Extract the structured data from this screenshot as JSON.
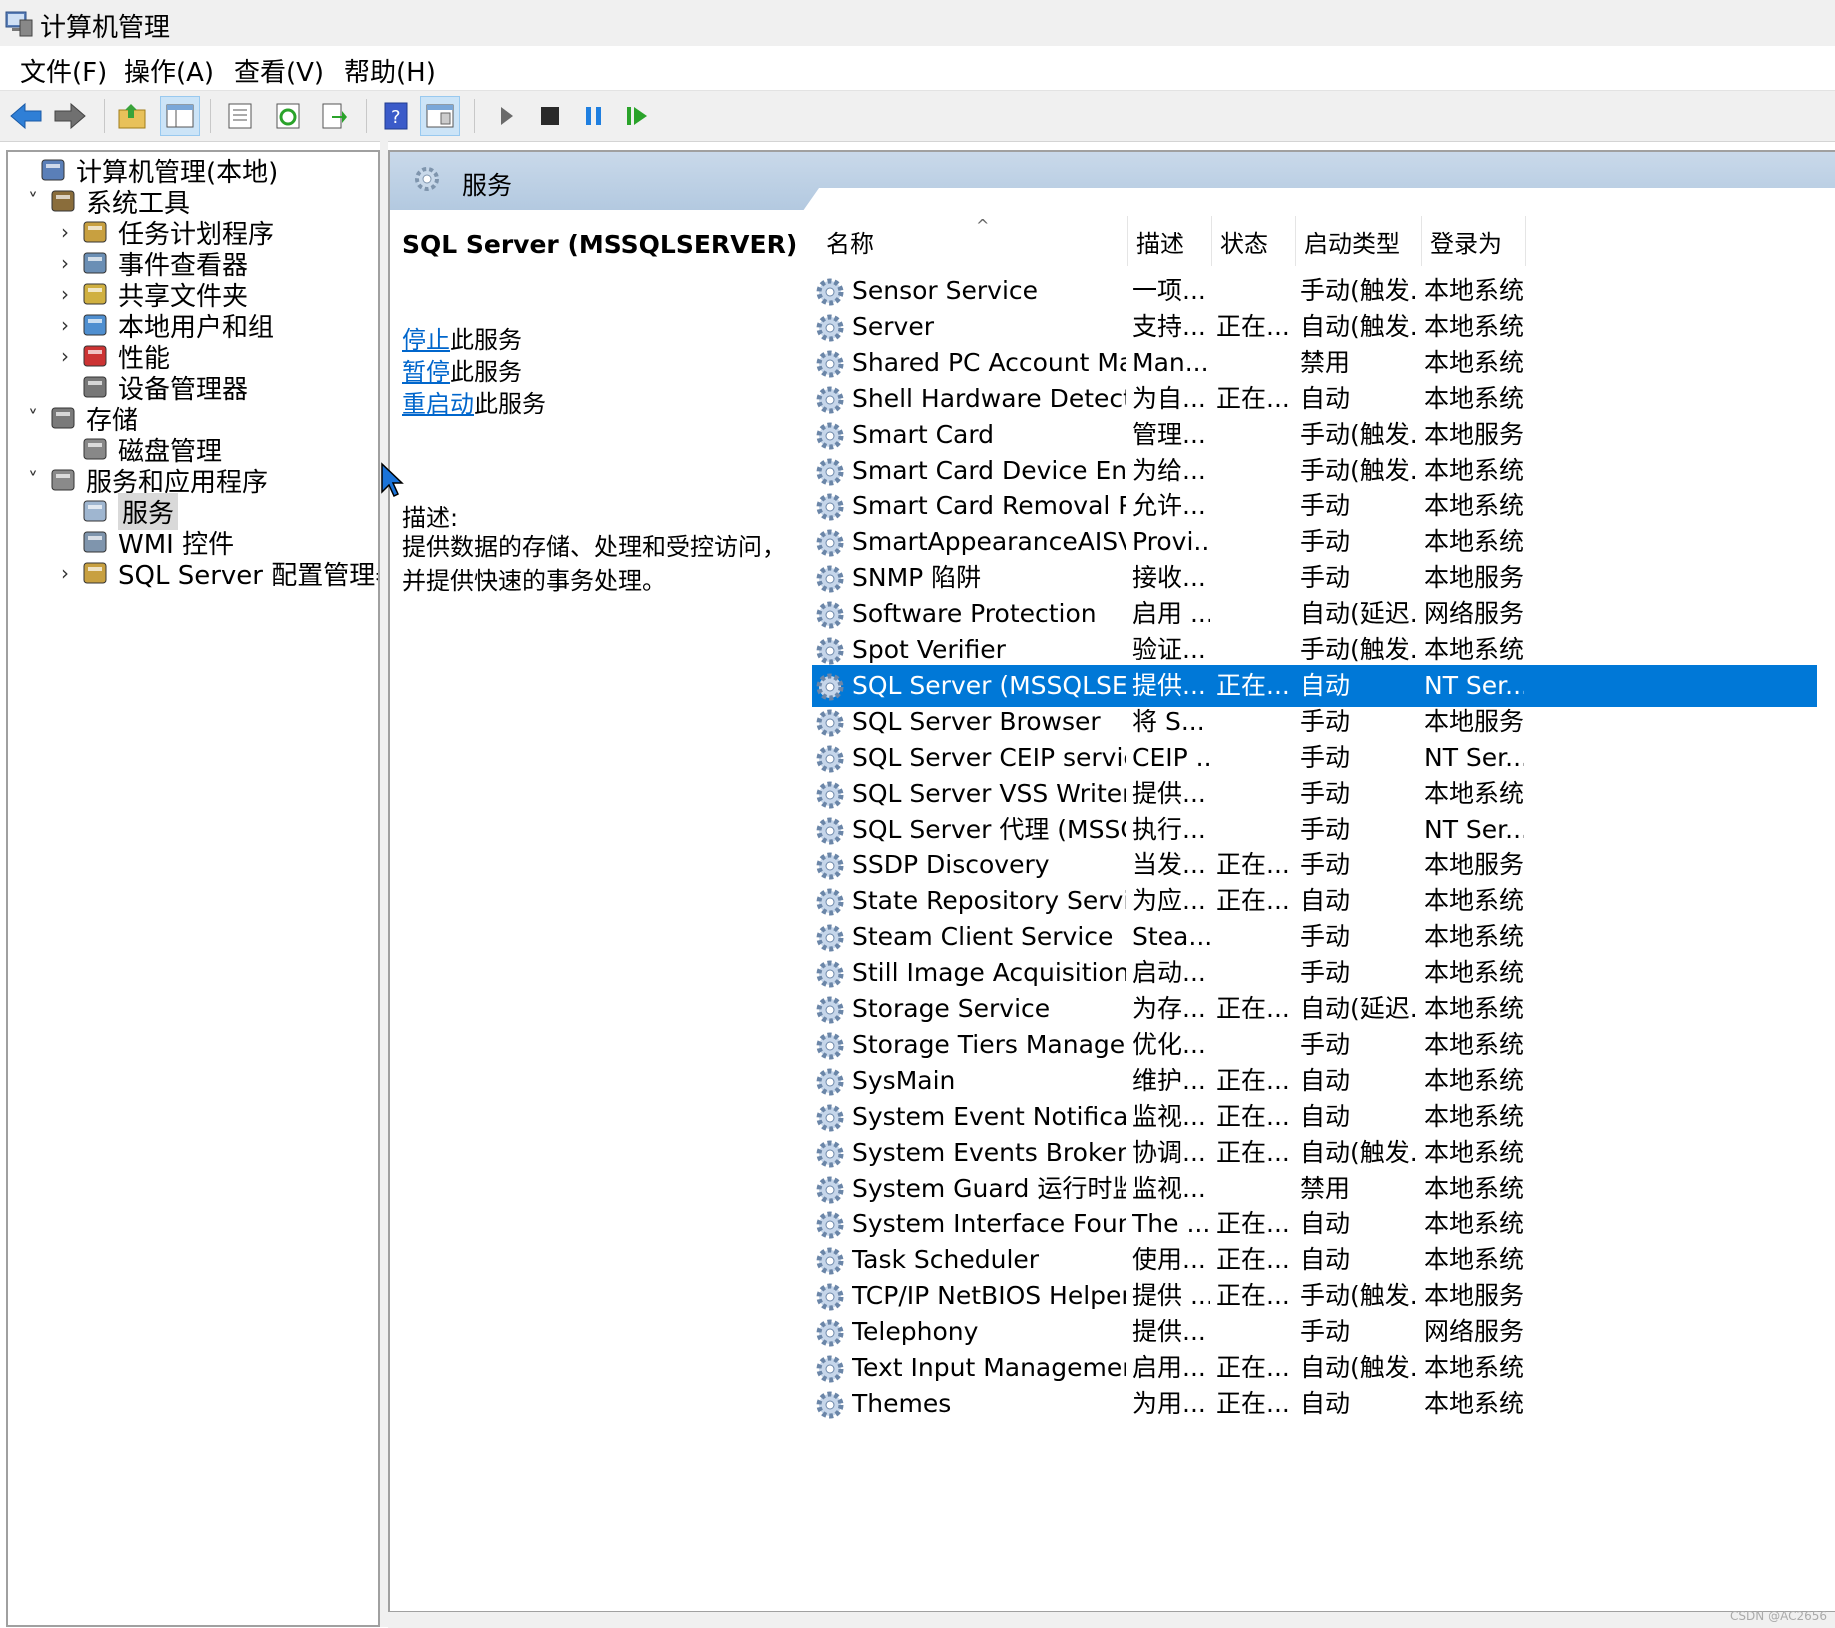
{
  "window": {
    "title": "计算机管理"
  },
  "menu": [
    "文件(F)",
    "操作(A)",
    "查看(V)",
    "帮助(H)"
  ],
  "toolbar": [
    "back-icon",
    "forward-icon",
    "up-folder-icon",
    "show-tree-icon",
    "properties-icon",
    "refresh-icon",
    "export-icon",
    "help-icon",
    "console-icon",
    "start-service-icon",
    "stop-service-icon",
    "pause-service-icon",
    "resume-service-icon"
  ],
  "tree": [
    {
      "label": "计算机管理(本地)",
      "icon": "computer-management-icon",
      "chev": ""
    },
    {
      "label": "系统工具",
      "icon": "system-tools-icon",
      "chev": "˅"
    },
    {
      "label": "任务计划程序",
      "icon": "task-scheduler-icon",
      "chev": "›"
    },
    {
      "label": "事件查看器",
      "icon": "event-viewer-icon",
      "chev": "›"
    },
    {
      "label": "共享文件夹",
      "icon": "shared-folders-icon",
      "chev": "›"
    },
    {
      "label": "本地用户和组",
      "icon": "users-groups-icon",
      "chev": "›"
    },
    {
      "label": "性能",
      "icon": "performance-icon",
      "chev": "›"
    },
    {
      "label": "设备管理器",
      "icon": "device-manager-icon",
      "chev": ""
    },
    {
      "label": "存储",
      "icon": "storage-icon",
      "chev": "˅"
    },
    {
      "label": "磁盘管理",
      "icon": "disk-management-icon",
      "chev": ""
    },
    {
      "label": "服务和应用程序",
      "icon": "services-apps-icon",
      "chev": "˅"
    },
    {
      "label": "服务",
      "icon": "services-icon",
      "chev": ""
    },
    {
      "label": "WMI 控件",
      "icon": "wmi-control-icon",
      "chev": ""
    },
    {
      "label": "SQL Server 配置管理器",
      "icon": "sql-config-manager-icon",
      "chev": "›"
    }
  ],
  "panel": {
    "header": "服务",
    "selected_service": "SQL Server (MSSQLSERVER)",
    "actions": [
      {
        "link": "停止",
        "suffix": "此服务"
      },
      {
        "link": "暂停",
        "suffix": "此服务"
      },
      {
        "link": "重启动",
        "suffix": "此服务"
      }
    ],
    "description_label": "描述:",
    "description": "提供数据的存储、处理和受控访问，并提供快速的事务处理。"
  },
  "columns": [
    "名称",
    "描述",
    "状态",
    "启动类型",
    "登录为"
  ],
  "sort_indicator": "^",
  "services": [
    [
      "Sensor Service",
      "一项...",
      "",
      "手动(触发...",
      "本地系统"
    ],
    [
      "Server",
      "支持...",
      "正在...",
      "自动(触发...",
      "本地系统"
    ],
    [
      "Shared PC Account Manager",
      "Man...",
      "",
      "禁用",
      "本地系统"
    ],
    [
      "Shell Hardware Detection",
      "为自...",
      "正在...",
      "自动",
      "本地系统"
    ],
    [
      "Smart Card",
      "管理...",
      "",
      "手动(触发...",
      "本地服务"
    ],
    [
      "Smart Card Device Enumer...",
      "为给...",
      "",
      "手动(触发...",
      "本地系统"
    ],
    [
      "Smart Card Removal Policy",
      "允许...",
      "",
      "手动",
      "本地系统"
    ],
    [
      "SmartAppearanceAISVC",
      "Provi...",
      "",
      "手动",
      "本地系统"
    ],
    [
      "SNMP 陷阱",
      "接收...",
      "",
      "手动",
      "本地服务"
    ],
    [
      "Software Protection",
      "启用 ...",
      "",
      "自动(延迟...",
      "网络服务"
    ],
    [
      "Spot Verifier",
      "验证...",
      "",
      "手动(触发...",
      "本地系统"
    ],
    [
      "SQL Server (MSSQLSERVER)",
      "提供...",
      "正在...",
      "自动",
      "NT Ser..."
    ],
    [
      "SQL Server Browser",
      "将 S...",
      "",
      "手动",
      "本地服务"
    ],
    [
      "SQL Server CEIP service (M...",
      "CEIP ...",
      "",
      "手动",
      "NT Ser..."
    ],
    [
      "SQL Server VSS Writer",
      "提供...",
      "",
      "手动",
      "本地系统"
    ],
    [
      "SQL Server 代理 (MSSQLS...",
      "执行...",
      "",
      "手动",
      "NT Ser..."
    ],
    [
      "SSDP Discovery",
      "当发...",
      "正在...",
      "手动",
      "本地服务"
    ],
    [
      "State Repository Service",
      "为应...",
      "正在...",
      "自动",
      "本地系统"
    ],
    [
      "Steam Client Service",
      "Stea...",
      "",
      "手动",
      "本地系统"
    ],
    [
      "Still Image Acquisition Eve...",
      "启动...",
      "",
      "手动",
      "本地系统"
    ],
    [
      "Storage Service",
      "为存...",
      "正在...",
      "自动(延迟...",
      "本地系统"
    ],
    [
      "Storage Tiers Management",
      "优化...",
      "",
      "手动",
      "本地系统"
    ],
    [
      "SysMain",
      "维护...",
      "正在...",
      "自动",
      "本地系统"
    ],
    [
      "System Event Notification ...",
      "监视...",
      "正在...",
      "自动",
      "本地系统"
    ],
    [
      "System Events Broker",
      "协调...",
      "正在...",
      "自动(触发...",
      "本地系统"
    ],
    [
      "System Guard 运行时监视...",
      "监视...",
      "",
      "禁用",
      "本地系统"
    ],
    [
      "System Interface Foundati...",
      "The ...",
      "正在...",
      "自动",
      "本地系统"
    ],
    [
      "Task Scheduler",
      "使用...",
      "正在...",
      "自动",
      "本地系统"
    ],
    [
      "TCP/IP NetBIOS Helper",
      "提供 ...",
      "正在...",
      "手动(触发...",
      "本地服务"
    ],
    [
      "Telephony",
      "提供...",
      "",
      "手动",
      "网络服务"
    ],
    [
      "Text Input Management S...",
      "启用...",
      "正在...",
      "自动(触发...",
      "本地系统"
    ],
    [
      "Themes",
      "为用...",
      "正在...",
      "自动",
      "本地系统"
    ]
  ],
  "selected_row": 11,
  "watermark": "CSDN @AC2656",
  "colors": {
    "selection": "#0078d7",
    "link": "#0066cc",
    "header_band": "#b3c9e0"
  }
}
